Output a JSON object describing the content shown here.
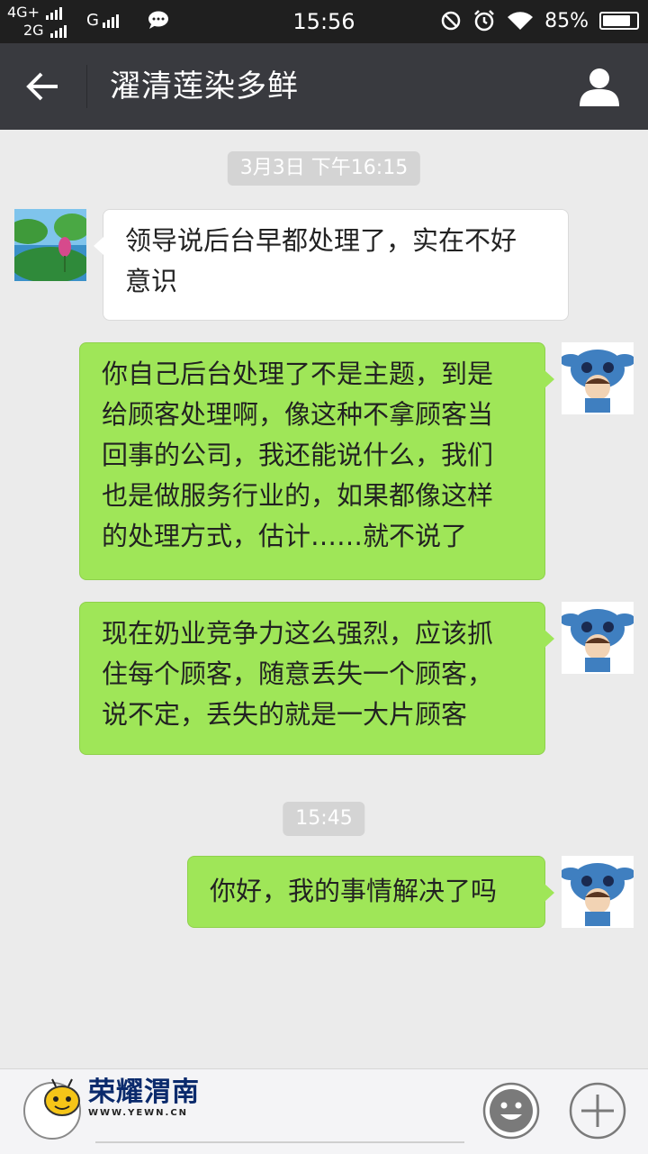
{
  "status_bar": {
    "network_top": "4G+",
    "network_bottom": "2G",
    "network_g": "G",
    "time": "15:56",
    "battery_percent": "85%",
    "battery_level": 0.85
  },
  "header": {
    "back_icon": "arrow-left-icon",
    "title": "濯清莲染多鲜",
    "profile_icon": "person-icon"
  },
  "messages": {
    "time1": "3月3日 下午16:15",
    "m1": "领导说后台早都处理了，实在不好\n意识",
    "m2": "你自己后台处理了不是主题，到是\n给顾客处理啊，像这种不拿顾客当\n回事的公司，我还能说什么，我们\n也是做服务行业的，如果都像这样\n的处理方式，估计……就不说了",
    "m3": "现在奶业竞争力这么强烈，应该抓\n住每个顾客，随意丢失一个顾客，\n说不定，丢失的就是一大片顾客",
    "time2": "15:45",
    "m4": "你好，我的事情解决了吗"
  },
  "watermark": {
    "name": "荣耀渭南",
    "url": "WWW.YEWN.CN"
  },
  "colors": {
    "header_bg": "#393a3f",
    "outgoing_bubble": "#9fe658",
    "incoming_bubble": "#ffffff",
    "chat_bg": "#ebebeb"
  }
}
